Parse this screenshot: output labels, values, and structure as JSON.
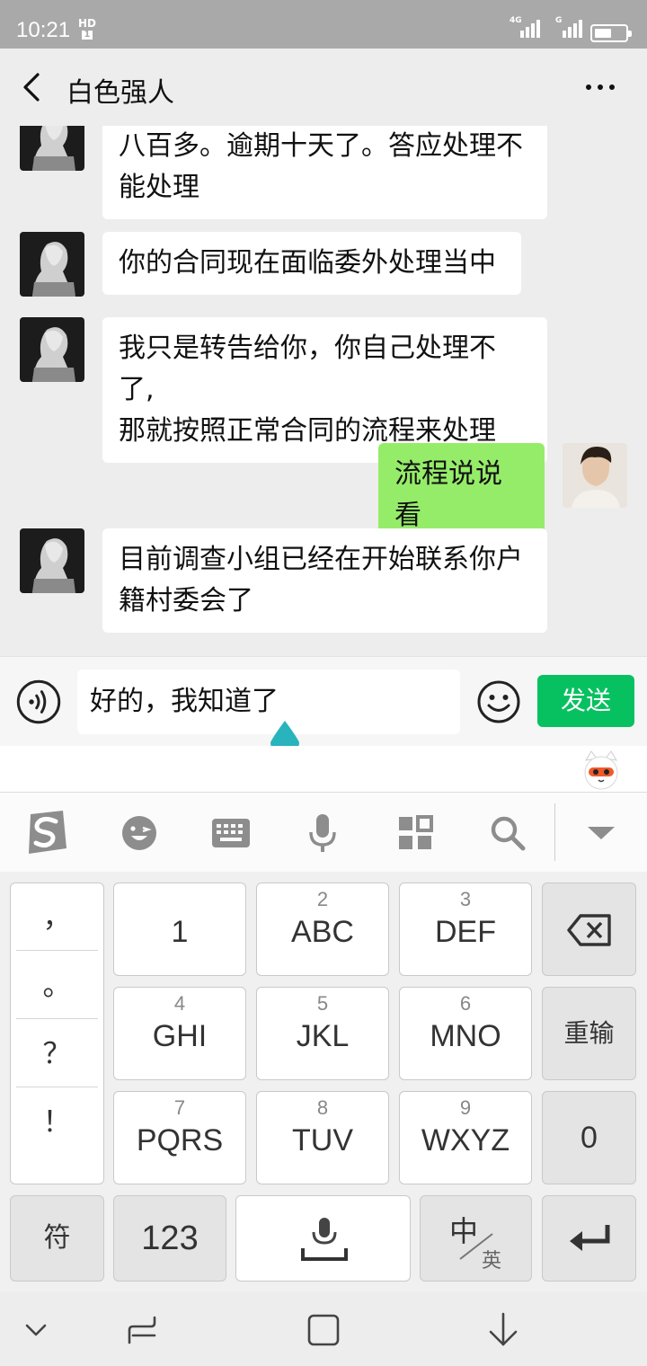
{
  "status_bar": {
    "time": "10:21",
    "hd_label": "HD",
    "hd_sub": "1",
    "network_1": "4G",
    "network_2": "G",
    "battery_level": 0.55
  },
  "header": {
    "title": "白色强人",
    "back_icon": "chevron-left-icon",
    "more_icon": "more-horizontal-icon"
  },
  "messages": [
    {
      "sender": "other",
      "text_lines": [
        "八百多。逾期十天了。答应处理不",
        "能处理"
      ]
    },
    {
      "sender": "other",
      "text_lines": [
        "你的合同现在面临委外处理当中"
      ]
    },
    {
      "sender": "other",
      "text_lines": [
        "我只是转告给你，你自己处理不了,",
        "那就按照正常合同的流程来处理"
      ]
    },
    {
      "sender": "me",
      "text_lines": [
        "流程说说看"
      ]
    },
    {
      "sender": "other",
      "text_lines": [
        "目前调查小组已经在开始联系你户",
        "籍村委会了"
      ]
    }
  ],
  "input_bar": {
    "value": "好的，我知道了",
    "send_label": "发送",
    "voice_icon": "voice-input-icon",
    "emoji_icon": "emoji-icon"
  },
  "keyboard_toolbar": {
    "icons": [
      "sogou-logo-icon",
      "emoticon-icon",
      "keyboard-icon",
      "microphone-icon",
      "apps-grid-icon",
      "search-icon",
      "collapse-down-icon"
    ]
  },
  "keyboard": {
    "punctuation": [
      "，",
      "。",
      "？",
      "！"
    ],
    "rows": [
      [
        {
          "num": "",
          "letters": "1"
        },
        {
          "num": "2",
          "letters": "ABC"
        },
        {
          "num": "3",
          "letters": "DEF"
        }
      ],
      [
        {
          "num": "4",
          "letters": "GHI"
        },
        {
          "num": "5",
          "letters": "JKL"
        },
        {
          "num": "6",
          "letters": "MNO"
        }
      ],
      [
        {
          "num": "7",
          "letters": "PQRS"
        },
        {
          "num": "8",
          "letters": "TUV"
        },
        {
          "num": "9",
          "letters": "WXYZ"
        }
      ]
    ],
    "reinput_label": "重输",
    "zero_label": "0",
    "symbol_label": "符",
    "numbers_label": "123",
    "lang_main": "中",
    "lang_sub": "英"
  },
  "nav_bar": {
    "icons": [
      "nav-down-icon",
      "nav-recent-icon",
      "nav-home-icon",
      "nav-back-icon"
    ]
  }
}
